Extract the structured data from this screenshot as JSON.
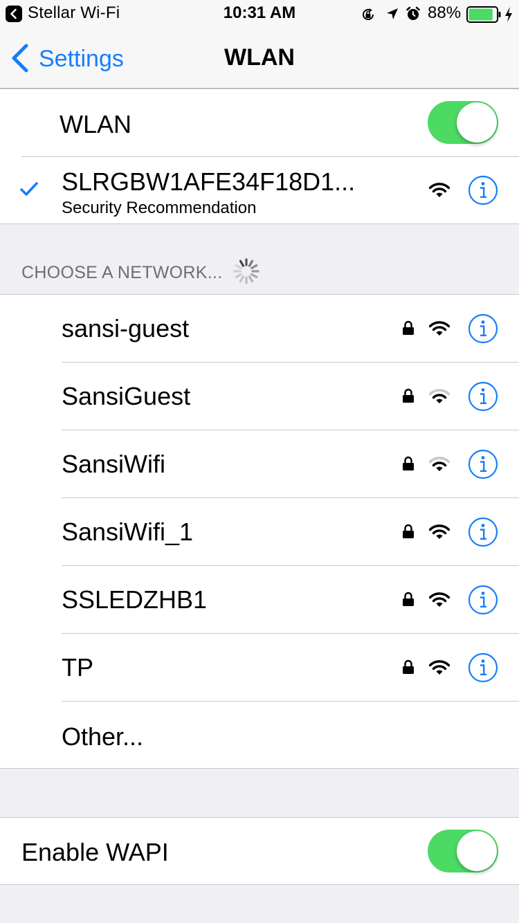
{
  "status_bar": {
    "carrier": "Stellar Wi-Fi",
    "time": "10:31 AM",
    "battery": "88%",
    "battery_level": 0.88,
    "icons": [
      "back-to-app-icon",
      "orientation-lock-icon",
      "location-arrow-icon",
      "alarm-icon",
      "battery-icon",
      "charging-bolt-icon"
    ]
  },
  "nav": {
    "back_label": "Settings",
    "title": "WLAN"
  },
  "wlan_toggle": {
    "label": "WLAN",
    "on": true
  },
  "connected": {
    "name": "SLRGBW1AFE34F18D1...",
    "subtitle": "Security Recommendation",
    "checked": true,
    "signal": "full"
  },
  "section_header": "CHOOSE A NETWORK...",
  "networks": [
    {
      "name": "sansi-guest",
      "locked": true,
      "signal": "full"
    },
    {
      "name": "SansiGuest",
      "locked": true,
      "signal": "low"
    },
    {
      "name": "SansiWifi",
      "locked": true,
      "signal": "low"
    },
    {
      "name": "SansiWifi_1",
      "locked": true,
      "signal": "full"
    },
    {
      "name": "SSLEDZHB1",
      "locked": true,
      "signal": "full"
    },
    {
      "name": "TP",
      "locked": true,
      "signal": "full"
    }
  ],
  "other_label": "Other...",
  "wapi_toggle": {
    "label": "Enable WAPI",
    "on": true
  },
  "colors": {
    "accent": "#157efb",
    "toggle_on": "#4cd964",
    "battery_fill": "#4cd964",
    "background": "#efeff4"
  }
}
